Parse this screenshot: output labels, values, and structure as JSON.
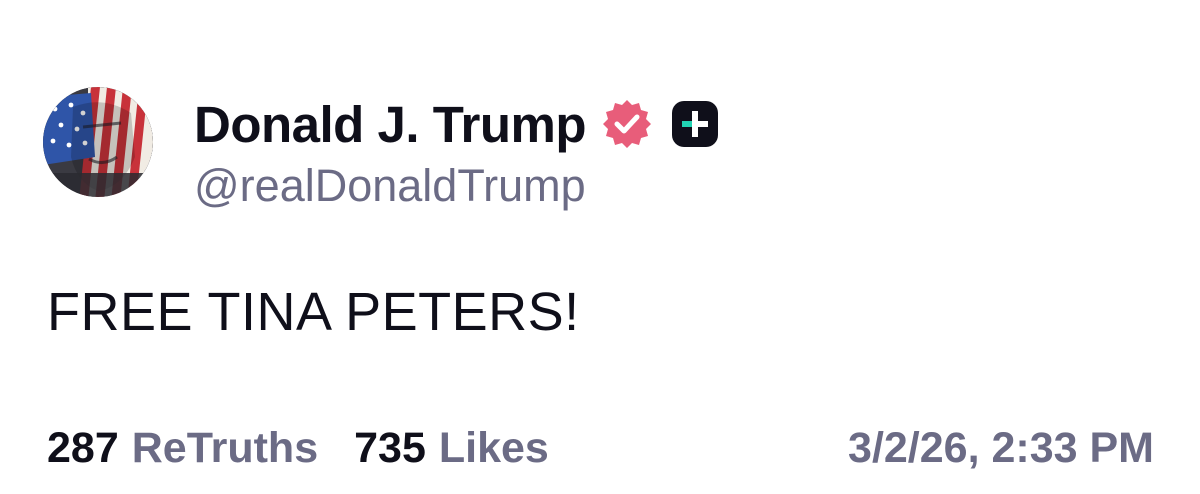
{
  "post": {
    "author": {
      "display_name": "Donald J. Trump",
      "handle": "@realDonaldTrump",
      "avatar_icon": "flag-portrait-avatar",
      "verified_icon": "verified-badge-icon",
      "plus_icon": "truth-plus-icon"
    },
    "text": "FREE TINA PETERS!",
    "stats": {
      "retruths_count": "287",
      "retruths_label": "ReTruths",
      "likes_count": "735",
      "likes_label": "Likes"
    },
    "timestamp": "3/2/26, 2:33 PM"
  },
  "colors": {
    "text_primary": "#0f0f1a",
    "text_secondary": "#6b6b85",
    "verified_badge": "#e85d7a",
    "plus_badge": "#0f0f1a",
    "plus_accent": "#21d3b3"
  }
}
